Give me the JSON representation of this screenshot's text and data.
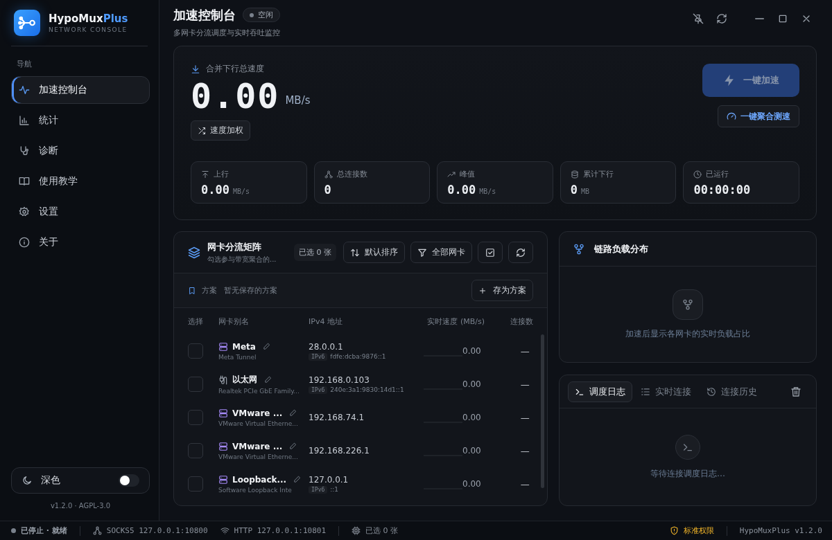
{
  "app": {
    "name": "HypoMux",
    "name_accent": "Plus",
    "subtitle": "NETWORK CONSOLE"
  },
  "sidebar": {
    "section": "导航",
    "items": [
      {
        "label": "加速控制台",
        "selected": true
      },
      {
        "label": "统计",
        "selected": false
      },
      {
        "label": "诊断",
        "selected": false
      },
      {
        "label": "使用教学",
        "selected": false
      },
      {
        "label": "设置",
        "selected": false
      },
      {
        "label": "关于",
        "selected": false
      }
    ],
    "theme": {
      "label": "深色",
      "on": false
    },
    "version": "v1.2.0 · AGPL-3.0"
  },
  "header": {
    "title": "加速控制台",
    "status": "空闲",
    "subtitle": "多网卡分流调度与实时吞吐监控"
  },
  "hero": {
    "label": "合并下行总速度",
    "value": "0.00",
    "unit": "MB/s",
    "weight_button": "速度加权",
    "boost_button": {
      "label": "一键加速",
      "disabled": true
    },
    "test_button": "一键聚合测速",
    "stats": [
      {
        "label": "上行",
        "value": "0.00",
        "unit": "MB/s"
      },
      {
        "label": "总连接数",
        "value": "0"
      },
      {
        "label": "峰值",
        "value": "0.00",
        "unit": "MB/s"
      },
      {
        "label": "累计下行",
        "value": "0",
        "unit": "MB"
      },
      {
        "label": "已运行",
        "value": "00:00:00"
      }
    ]
  },
  "matrix": {
    "title": "网卡分流矩阵",
    "subtitle": "勾选参与带宽聚合的...",
    "selected_count": "已选 0 张",
    "sort_button": "默认排序",
    "filter_button": "全部网卡",
    "plans_label": "方案",
    "plans_empty": "暂无保存的方案",
    "save_button": "存为方案",
    "columns": [
      "选择",
      "网卡别名",
      "IPv4 地址",
      "实时速度 (MB/s)",
      "连接数"
    ],
    "rows": [
      {
        "kind": "virtual",
        "name": "Meta",
        "description": "Meta Tunnel",
        "ipv4": "28.0.0.1",
        "ipv6_tag": "IPv6",
        "ipv6": "fdfe:dcba:9876::1",
        "speed": "0.00",
        "level": 0,
        "connections": "—",
        "checked": false
      },
      {
        "kind": "ethernet",
        "name": "以太网",
        "description": "Realtek PCIe GbE Family...",
        "ipv4": "192.168.0.103",
        "ipv6_tag": "IPv6",
        "ipv6": "240e:3a1:9830:14d1::1",
        "speed": "0.00",
        "level": 0,
        "connections": "—",
        "checked": false
      },
      {
        "kind": "virtual",
        "name": "VMware ...",
        "description": "VMware Virtual Etherne...",
        "ipv4": "192.168.74.1",
        "speed": "0.00",
        "level": 0,
        "connections": "—",
        "checked": false
      },
      {
        "kind": "virtual",
        "name": "VMware ...",
        "description": "VMware Virtual Etherne...",
        "ipv4": "192.168.226.1",
        "speed": "0.00",
        "level": 0,
        "connections": "—",
        "checked": false
      },
      {
        "kind": "virtual",
        "name": "Loopback...",
        "description": "Software Loopback Inte",
        "ipv4": "127.0.0.1",
        "ipv6_tag": "IPv6",
        "ipv6": "::1",
        "speed": "0.00",
        "level": 0,
        "connections": "—",
        "checked": false
      }
    ]
  },
  "load": {
    "title": "链路负载分布",
    "empty": "加速后显示各网卡的实时负载占比"
  },
  "log": {
    "tabs": [
      {
        "label": "调度日志",
        "selected": true
      },
      {
        "label": "实时连接",
        "selected": false
      },
      {
        "label": "连接历史",
        "selected": false
      }
    ],
    "empty": "等待连接调度日志…"
  },
  "status_bar": {
    "state": "已停止 · 就绪",
    "socks": "SOCKS5 127.0.0.1:10800",
    "http": "HTTP 127.0.0.1:10801",
    "selected": "已选 0 张",
    "permission": "标准权限",
    "version": "HypoMuxPlus v1.2.0"
  }
}
